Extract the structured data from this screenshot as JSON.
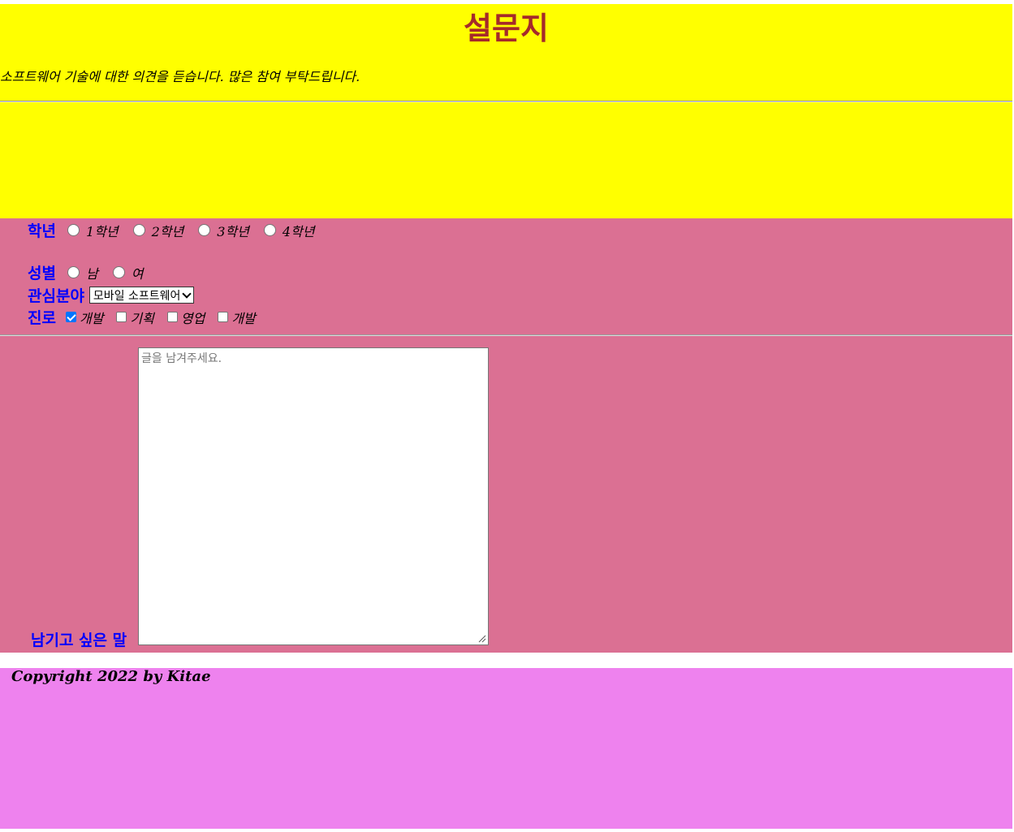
{
  "header": {
    "title": "설문지",
    "intro": "소프트웨어 기술에 대한 의견을 듣습니다. 많은 참여 부탁드립니다."
  },
  "form": {
    "grade": {
      "label": "학년",
      "options": [
        "1학년",
        "2학년",
        "3학년",
        "4학년"
      ]
    },
    "gender": {
      "label": "성별",
      "options": [
        "남",
        "여"
      ]
    },
    "interest": {
      "label": "관심분야",
      "selected": "모바일 소프트웨어"
    },
    "career": {
      "label": "진로",
      "options": [
        {
          "label": "개발",
          "checked": true
        },
        {
          "label": "기획",
          "checked": false
        },
        {
          "label": "영업",
          "checked": false
        },
        {
          "label": "개발",
          "checked": false
        }
      ]
    },
    "message": {
      "label": "남기고 싶은 말",
      "placeholder": "글을 남겨주세요."
    }
  },
  "footer": {
    "copyright": "Copyright 2022 by Kitae"
  },
  "colors": {
    "header_bg": "#ffff00",
    "title": "#a52a2a",
    "form_bg": "#db7093",
    "label": "#0000ff",
    "footer_bg": "#ee82ee",
    "checkbox_checked": "#0075ff"
  }
}
